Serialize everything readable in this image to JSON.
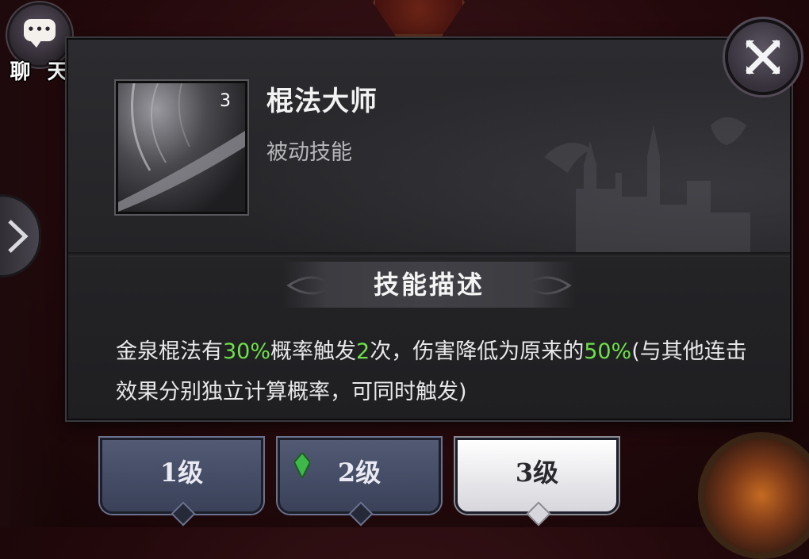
{
  "chat": {
    "label": "聊 天"
  },
  "skill": {
    "name": "棍法大师",
    "type": "被动技能",
    "level_badge": "3"
  },
  "description": {
    "header": "技能描述",
    "parts": [
      {
        "text": "金泉棍法有",
        "highlight": false
      },
      {
        "text": "30%",
        "highlight": true
      },
      {
        "text": "概率触发",
        "highlight": false
      },
      {
        "text": "2",
        "highlight": true
      },
      {
        "text": "次，伤害降低为原来的",
        "highlight": false
      },
      {
        "text": "50%",
        "highlight": true
      },
      {
        "text": "(与其他连击效果分别独立计算概率，可同时触发)",
        "highlight": false
      }
    ]
  },
  "tabs": [
    {
      "label": "1级",
      "active": false,
      "gem": false
    },
    {
      "label": "2级",
      "active": false,
      "gem": true
    },
    {
      "label": "3级",
      "active": true,
      "gem": false
    }
  ],
  "colors": {
    "highlight": "#6ee04a",
    "panel": "#242427",
    "tab": "#4a5169",
    "tab_active": "#ffffff"
  },
  "icons": {
    "chat": "speech-bubble-icon",
    "close": "close-x-icon",
    "side": "chevron-right-icon",
    "gem": "green-gem-icon"
  }
}
